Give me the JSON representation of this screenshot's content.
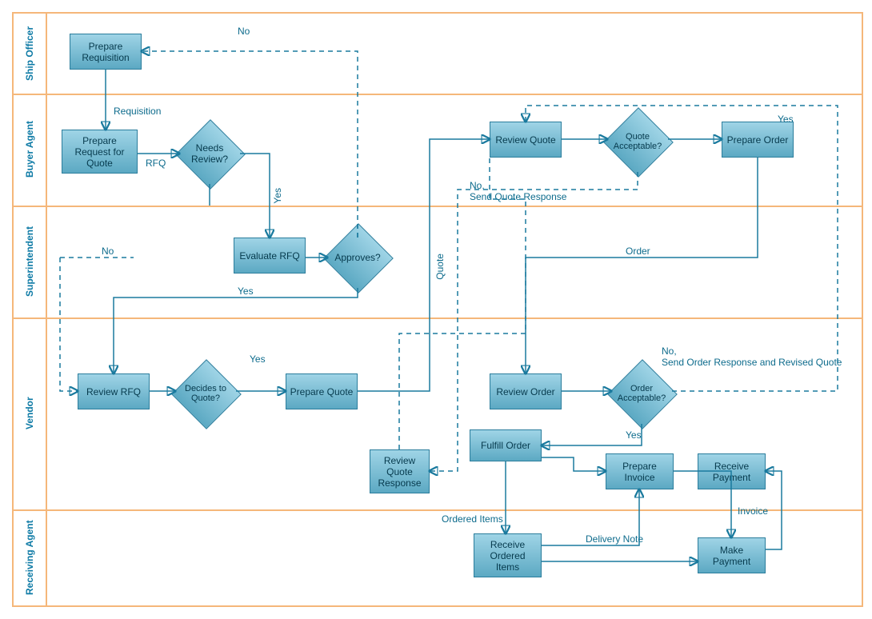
{
  "lanes": {
    "l1": "Ship Officer",
    "l2": "Buyer Agent",
    "l3": "Superintendent",
    "l4": "Vendor",
    "l5": "Receiving Agent"
  },
  "nodes": {
    "prep_req": "Prepare Requisition",
    "prep_rfq": "Prepare Request for Quote",
    "needs_review": "Needs Review?",
    "eval_rfq": "Evaluate RFQ",
    "approves": "Approves?",
    "review_rfq": "Review RFQ",
    "decides": "Decides to Quote?",
    "prep_quote": "Prepare Quote",
    "review_quote": "Review Quote",
    "quote_acc": "Quote Acceptable?",
    "prep_order": "Prepare Order",
    "review_order": "Review Order",
    "order_acc": "Order Acceptable?",
    "fulfill": "Fulfill Order",
    "rqr": "Review Quote Response",
    "prep_inv": "Prepare Invoice",
    "recv_pay": "Receive Payment",
    "recv_items": "Receive Ordered Items",
    "make_pay": "Make Payment"
  },
  "edges": {
    "no1": "No",
    "requisition": "Requisition",
    "rfq": "RFQ",
    "yes1": "Yes",
    "no2": "No",
    "yes2": "Yes",
    "yes3": "Yes",
    "quote": "Quote",
    "yes4": "Yes",
    "nsqr": "No,\nSend Quote Response",
    "order": "Order",
    "nsor": "No,\nSend Order Response and Revised Quote",
    "yes5": "Yes",
    "ordered": "Ordered Items",
    "delivery": "Delivery Note",
    "invoice": "Invoice"
  }
}
